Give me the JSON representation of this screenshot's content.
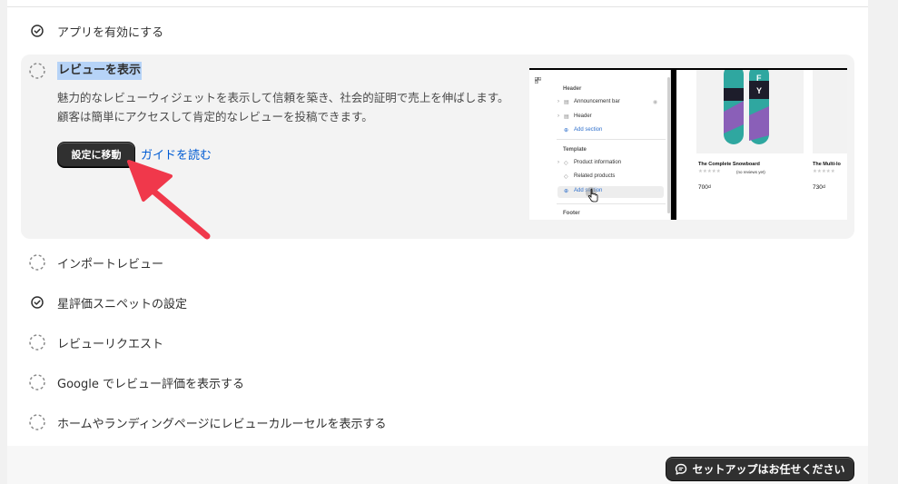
{
  "steps": {
    "enable_app": {
      "label": "アプリを有効にする",
      "done": true
    },
    "show_reviews": {
      "title": "レビューを表示",
      "description": "魅力的なレビューウィジェットを表示して信頼を築き、社会的証明で売上を伸ばします。顧客は簡単にアクセスして肯定的なレビューを投稿できます。",
      "primary_button": "設定に移動",
      "guide_link": "ガイドを読む",
      "done": false
    },
    "import_reviews": {
      "label": "インポートレビュー",
      "done": false
    },
    "star_snippets": {
      "label": "星評価スニペットの設定",
      "done": true
    },
    "review_requests": {
      "label": "レビューリクエスト",
      "done": false
    },
    "google_reviews": {
      "label": "Google でレビュー評価を表示する",
      "done": false
    },
    "carousel": {
      "label": "ホームやランディングページにレビューカルーセルを表示する",
      "done": false
    }
  },
  "preview": {
    "sections": {
      "header_section": "Header",
      "announcement_bar": "Announcement bar",
      "header_item": "Header",
      "add_section_1": "Add section",
      "template_section": "Template",
      "product_information": "Product information",
      "related_products": "Related products",
      "add_section_2": "Add section",
      "footer_section": "Footer"
    },
    "products": [
      {
        "title": "The Complete Snowboard",
        "stars": "★★★★★",
        "reviews": "(no reviews yet)",
        "price": "700₫"
      },
      {
        "title": "The Multi-lo",
        "stars": "★★★★★",
        "reviews": "",
        "price": "730₫"
      }
    ]
  },
  "help_button": {
    "label": "セットアップはお任せください",
    "icon": "chat-bubble-icon"
  },
  "colors": {
    "primary_button": "#303030",
    "link": "#005bd3",
    "highlight": "#b6d3f7",
    "arrow": "#f0384b"
  }
}
